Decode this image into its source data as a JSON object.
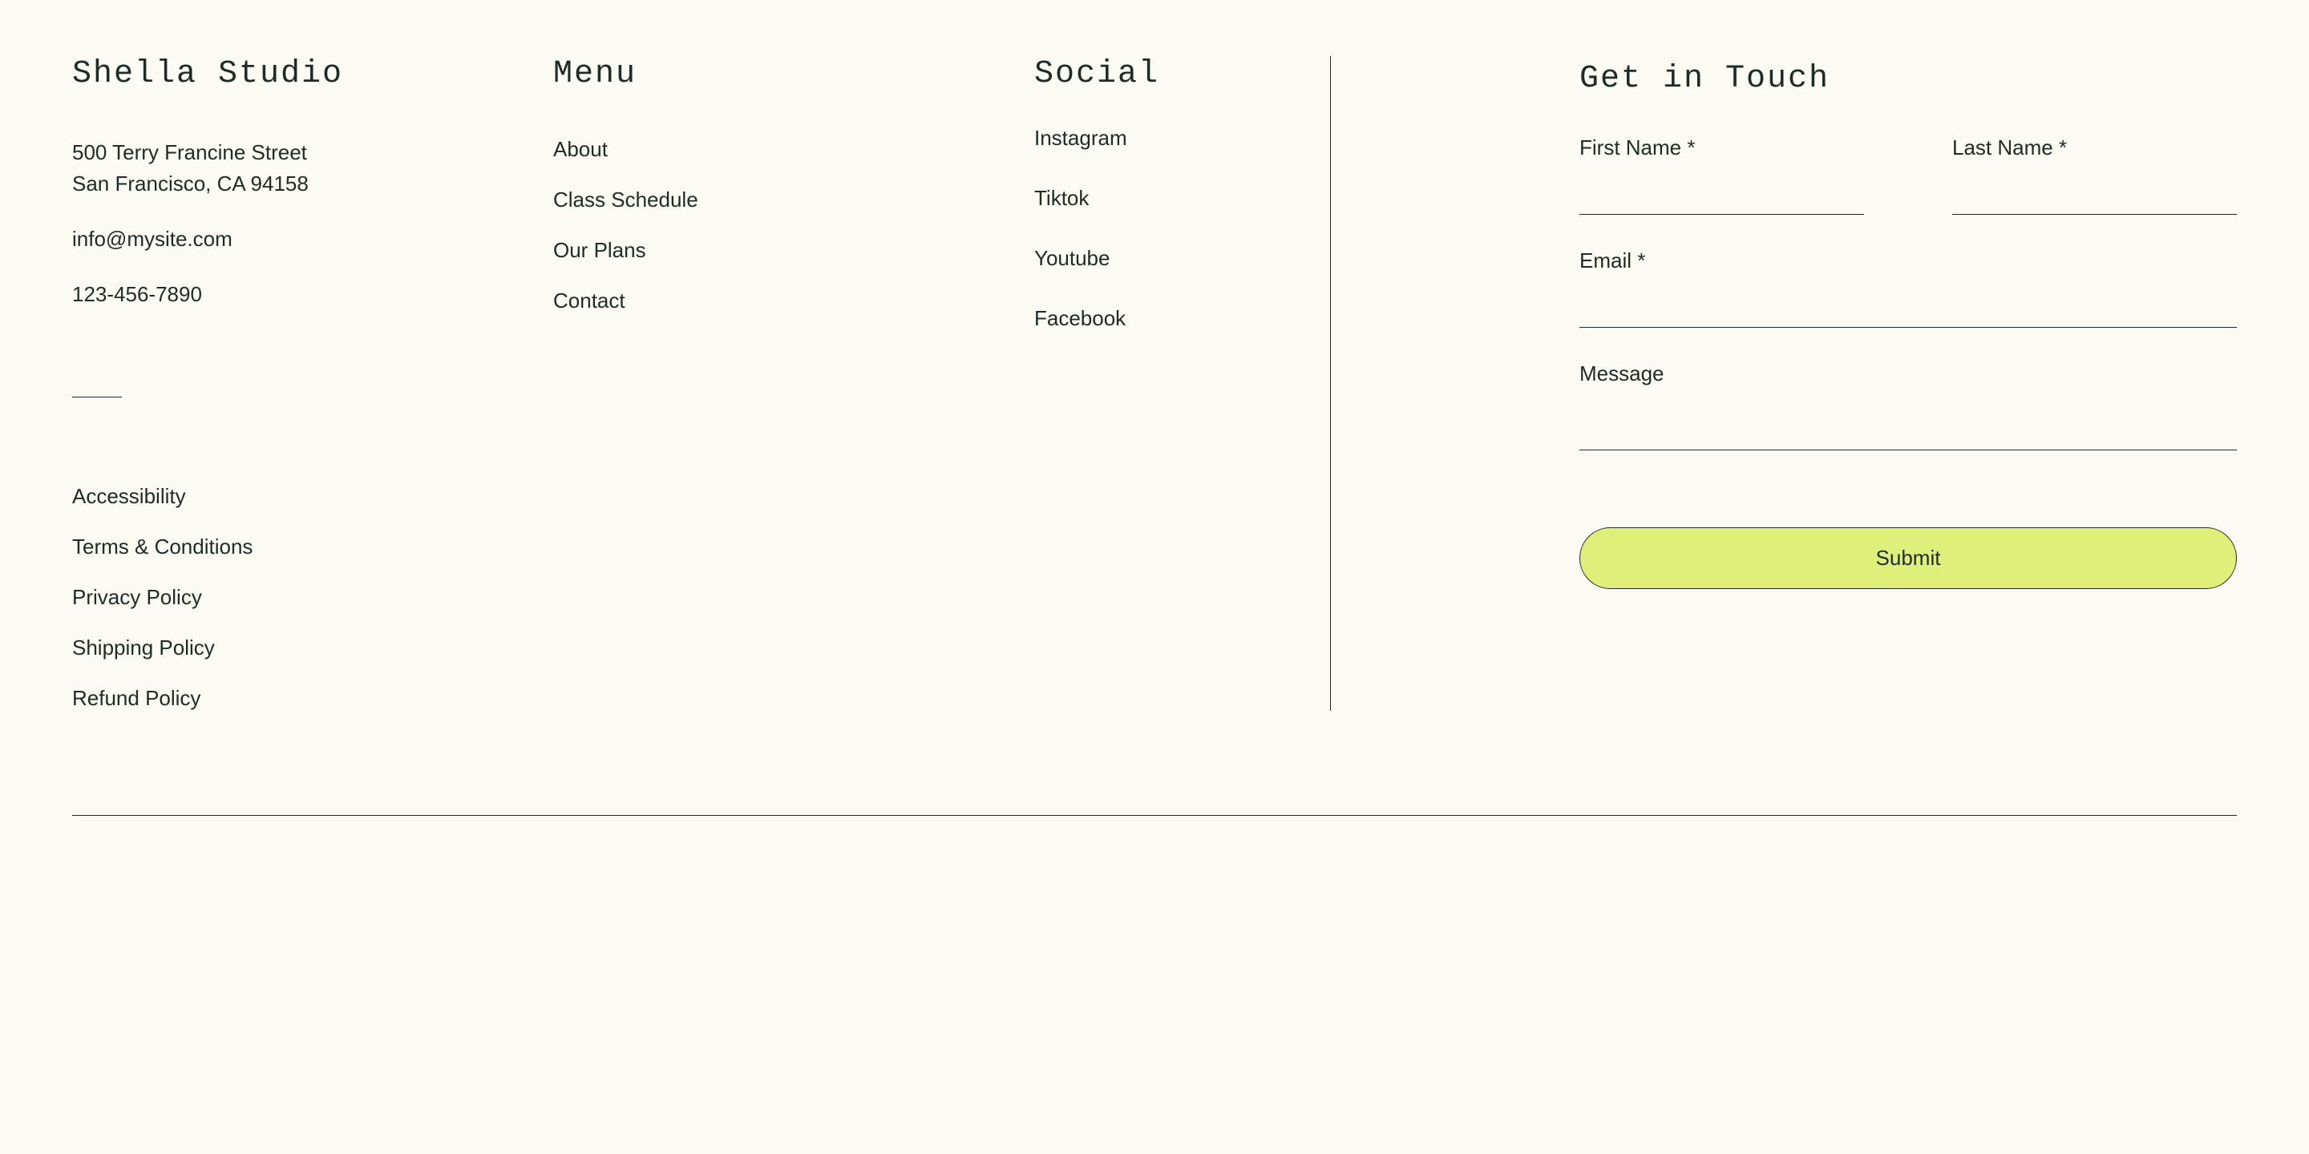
{
  "brand": {
    "name": "Shella Studio",
    "address_line1": "500 Terry Francine Street",
    "address_line2": "San Francisco, CA 94158",
    "email": "info@mysite.com",
    "phone": "123-456-7890"
  },
  "policies": {
    "items": [
      {
        "label": "Accessibility"
      },
      {
        "label": "Terms & Conditions"
      },
      {
        "label": "Privacy Policy"
      },
      {
        "label": "Shipping Policy"
      },
      {
        "label": "Refund Policy"
      }
    ]
  },
  "menu": {
    "heading": "Menu",
    "items": [
      {
        "label": "About"
      },
      {
        "label": "Class Schedule"
      },
      {
        "label": "Our Plans"
      },
      {
        "label": "Contact"
      }
    ]
  },
  "social": {
    "heading": "Social",
    "items": [
      {
        "label": "Instagram"
      },
      {
        "label": "Tiktok"
      },
      {
        "label": "Youtube"
      },
      {
        "label": "Facebook"
      }
    ]
  },
  "form": {
    "heading": "Get in Touch",
    "first_name_label": "First Name *",
    "last_name_label": "Last Name *",
    "email_label": "Email *",
    "message_label": "Message",
    "submit_label": "Submit"
  },
  "colors": {
    "background": "#fbfaf3",
    "text": "#1e2c29",
    "accent": "#dff07a"
  }
}
